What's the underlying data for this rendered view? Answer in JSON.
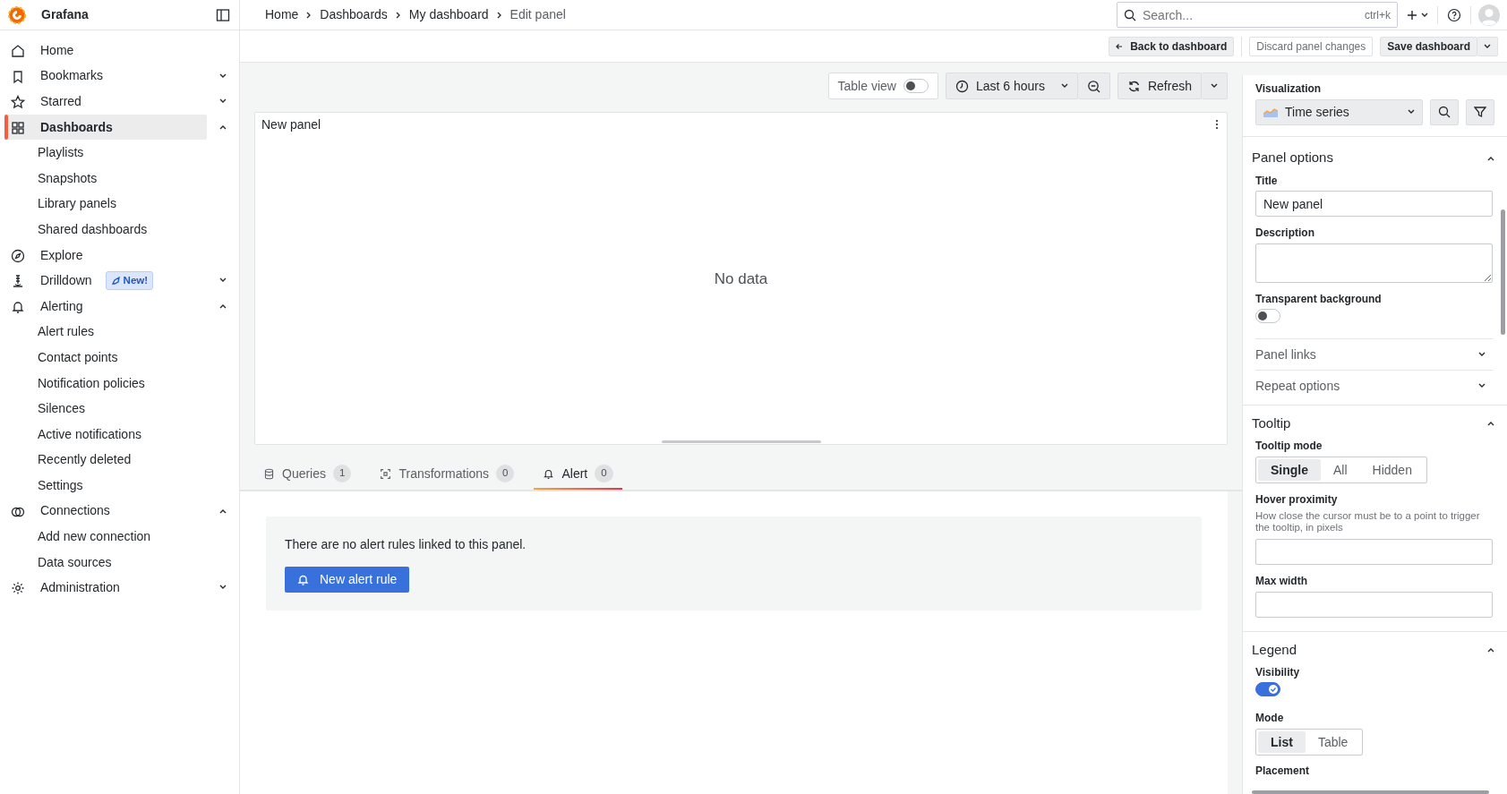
{
  "app": {
    "title": "Grafana"
  },
  "sidebar": {
    "items": [
      {
        "label": "Home",
        "selected": false
      },
      {
        "label": "Bookmarks",
        "selected": false,
        "expanded": false
      },
      {
        "label": "Starred",
        "selected": false,
        "expanded": false
      },
      {
        "label": "Dashboards",
        "selected": true,
        "expanded": true,
        "children": [
          {
            "label": "Playlists",
            "selected": false
          },
          {
            "label": "Snapshots",
            "selected": false
          },
          {
            "label": "Library panels",
            "selected": false
          },
          {
            "label": "Shared dashboards",
            "selected": false
          }
        ]
      },
      {
        "label": "Explore",
        "selected": false
      },
      {
        "label": "Drilldown",
        "selected": false,
        "expanded": false,
        "badge": "New!"
      },
      {
        "label": "Alerting",
        "selected": false,
        "expanded": true,
        "children": [
          {
            "label": "Alert rules",
            "selected": false
          },
          {
            "label": "Contact points",
            "selected": false
          },
          {
            "label": "Notification policies",
            "selected": false
          },
          {
            "label": "Silences",
            "selected": false
          },
          {
            "label": "Active notifications",
            "selected": false
          },
          {
            "label": "Recently deleted",
            "selected": false
          },
          {
            "label": "Settings",
            "selected": false
          }
        ]
      },
      {
        "label": "Connections",
        "selected": false,
        "expanded": true,
        "children": [
          {
            "label": "Add new connection",
            "selected": false
          },
          {
            "label": "Data sources",
            "selected": false
          }
        ]
      },
      {
        "label": "Administration",
        "selected": false,
        "expanded": false
      }
    ]
  },
  "breadcrumbs": [
    "Home",
    "Dashboards",
    "My dashboard",
    "Edit panel"
  ],
  "search": {
    "placeholder": "Search...",
    "shortcut": "ctrl+k"
  },
  "actions": {
    "back": "Back to dashboard",
    "discard": "Discard panel changes",
    "save": "Save dashboard"
  },
  "panel_toolbar": {
    "table_view": {
      "label": "Table view",
      "on": false
    },
    "time_range": "Last 6 hours",
    "refresh": "Refresh"
  },
  "panel": {
    "title": "New panel",
    "message": "No data"
  },
  "tabs": [
    {
      "label": "Queries",
      "count": "1",
      "selected": false
    },
    {
      "label": "Transformations",
      "count": "0",
      "selected": false
    },
    {
      "label": "Alert",
      "count": "0",
      "selected": true
    }
  ],
  "alert_tab": {
    "message": "There are no alert rules linked to this panel.",
    "button": "New alert rule"
  },
  "options": {
    "visualization": {
      "label": "Visualization",
      "value": "Time series"
    },
    "sections": [
      {
        "title": "Panel options",
        "expanded": true,
        "fields": [
          {
            "kind": "text",
            "label": "Title",
            "value": "New panel"
          },
          {
            "kind": "textarea",
            "label": "Description"
          },
          {
            "kind": "switch",
            "label": "Transparent background",
            "on": false
          },
          {
            "kind": "group",
            "label": "Panel links",
            "expanded": false
          },
          {
            "kind": "group",
            "label": "Repeat options",
            "expanded": false
          }
        ]
      },
      {
        "title": "Tooltip",
        "expanded": true,
        "fields": [
          {
            "kind": "radio",
            "label": "Tooltip mode",
            "options": [
              {
                "label": "Single",
                "selected": true
              },
              {
                "label": "All",
                "selected": false
              },
              {
                "label": "Hidden",
                "selected": false
              }
            ]
          },
          {
            "kind": "text",
            "label": "Hover proximity",
            "description": "How close the cursor must be to a point to trigger the tooltip, in pixels"
          },
          {
            "kind": "text",
            "label": "Max width"
          }
        ]
      },
      {
        "title": "Legend",
        "expanded": true,
        "fields": [
          {
            "kind": "switch",
            "label": "Visibility",
            "on": true
          },
          {
            "kind": "radio",
            "label": "Mode",
            "options": [
              {
                "label": "List",
                "selected": true
              },
              {
                "label": "Table",
                "selected": false
              }
            ]
          },
          {
            "kind": "label",
            "label": "Placement"
          }
        ]
      }
    ]
  }
}
